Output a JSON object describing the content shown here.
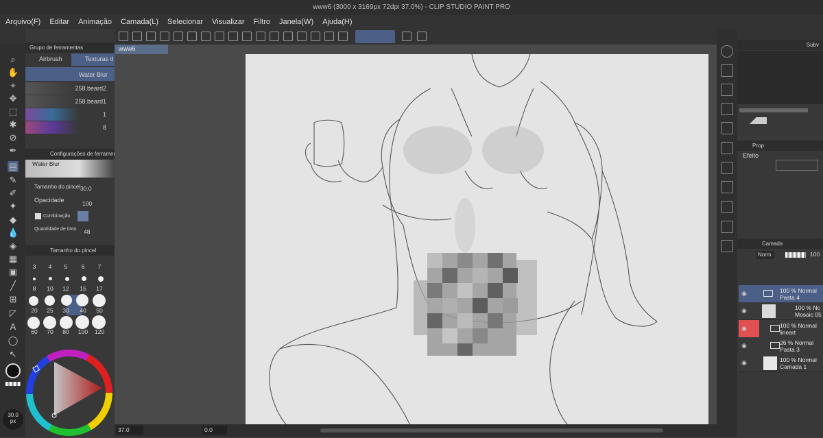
{
  "window": {
    "title": "www6 (3000 x 3169px 72dpi 37.0%)  - CLIP STUDIO PAINT PRO"
  },
  "menu": [
    "Arquivo(F)",
    "Editar",
    "Animação",
    "Camada(L)",
    "Selecionar",
    "Visualizar",
    "Filtro",
    "Janela(W)",
    "Ajuda(H)"
  ],
  "toolgroup": {
    "title": "Grupo de ferramentas",
    "tab_airbrush": "Airbrush",
    "tab_textures": "Texturas d"
  },
  "subtools": [
    {
      "label": "Water Blur"
    },
    {
      "label": "258.beard2"
    },
    {
      "label": "258.beard1"
    },
    {
      "label": "1"
    },
    {
      "label": "8"
    }
  ],
  "tool_settings": {
    "title": "Configurações de ferramen",
    "brush_name": "Water Blur",
    "size_label": "Tamanho do pincel",
    "size_value": "30.0",
    "opacity_label": "Opacidade",
    "opacity_value": "100",
    "blend_label": "Combinação",
    "ink_label": "Quantidade de tinta",
    "ink_value": "48"
  },
  "brush_size": {
    "title": "Tamanho do pincel",
    "rows": [
      [
        "3",
        "4",
        "5",
        "6",
        "7"
      ],
      [
        "8",
        "10",
        "12",
        "15",
        "17"
      ],
      [
        "20",
        "25",
        "30",
        "40",
        "50"
      ],
      [
        "60",
        "70",
        "80",
        "100",
        "120"
      ]
    ],
    "selected": "30"
  },
  "size_readout": {
    "value": "30.0",
    "unit": "px"
  },
  "document": {
    "tab": "www6"
  },
  "status": {
    "zoom": "37.0",
    "angle": "0.0"
  },
  "right_panel": {
    "nav_tab": "Subv",
    "props_tab": "Prop",
    "effect_label": "Efeito",
    "layer_tab": "Camada",
    "blend_mode": "Norm",
    "opacity": "100"
  },
  "layers": [
    {
      "pct": "100 %",
      "mode": "Normal",
      "name": "Pasta 4"
    },
    {
      "pct": "100 %",
      "mode": "Nc",
      "name": "Mosaic 05"
    },
    {
      "pct": "100 %",
      "mode": "Normal",
      "name": "lineart"
    },
    {
      "pct": "26 %",
      "mode": "Normal",
      "name": "Pasta 3"
    },
    {
      "pct": "100 %",
      "mode": "Normal",
      "name": "Camada 1"
    }
  ],
  "colors": {
    "accent": "#4c5f86",
    "red_row": "#e05050"
  }
}
